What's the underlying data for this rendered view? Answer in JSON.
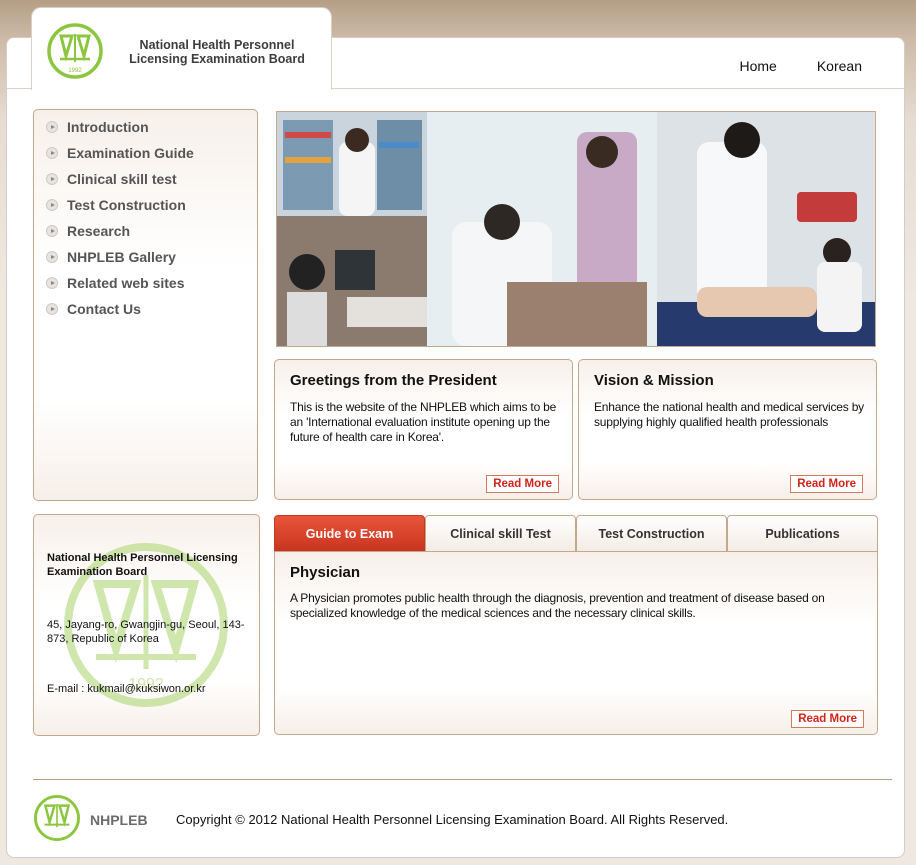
{
  "header": {
    "title": "National Health Personnel Licensing Examination Board",
    "logo_year": "1992",
    "nav": [
      {
        "label": "Home"
      },
      {
        "label": "Korean"
      }
    ]
  },
  "sidebar": {
    "items": [
      {
        "label": "Introduction"
      },
      {
        "label": "Examination Guide"
      },
      {
        "label": "Clinical skill test"
      },
      {
        "label": "Test Construction"
      },
      {
        "label": "Research"
      },
      {
        "label": "NHPLEB Gallery"
      },
      {
        "label": "Related web sites"
      },
      {
        "label": "Contact Us"
      }
    ]
  },
  "contact": {
    "name": "National Health Personnel Licensing Examination Board",
    "address": "45, Jayang-ro, Gwangjin-gu, Seoul, 143-873, Republic of Korea",
    "email": "E-mail : kukmail@kuksiwon.or.kr",
    "watermark_year": "1992"
  },
  "cards": {
    "greeting": {
      "title": "Greetings from the President",
      "body": "This is the website of the NHPLEB which aims to be an 'International evaluation institute opening up the future of health care in Korea'.",
      "more": "Read More"
    },
    "vision": {
      "title": "Vision & Mission",
      "body": "Enhance the national health and medical services by supplying highly qualified health professionals",
      "more": "Read More"
    }
  },
  "tabs": {
    "items": [
      {
        "label": "Guide to Exam",
        "active": true
      },
      {
        "label": "Clinical skill Test",
        "active": false
      },
      {
        "label": "Test Construction",
        "active": false
      },
      {
        "label": "Publications",
        "active": false
      }
    ],
    "panel": {
      "title": "Physician",
      "body": "A Physician promotes public health through the diagnosis, prevention and treatment of disease based on specialized knowledge of the medical sciences and the necessary clinical skills.",
      "more": "Read More"
    }
  },
  "footer": {
    "brand": "NHPLEB",
    "copyright": "Copyright © 2012 National Health Personnel Licensing Examination Board. All Rights Reserved."
  },
  "colors": {
    "brand_green": "#8cc63f",
    "accent_red": "#d0231b",
    "border_brown": "#c3a88e"
  }
}
